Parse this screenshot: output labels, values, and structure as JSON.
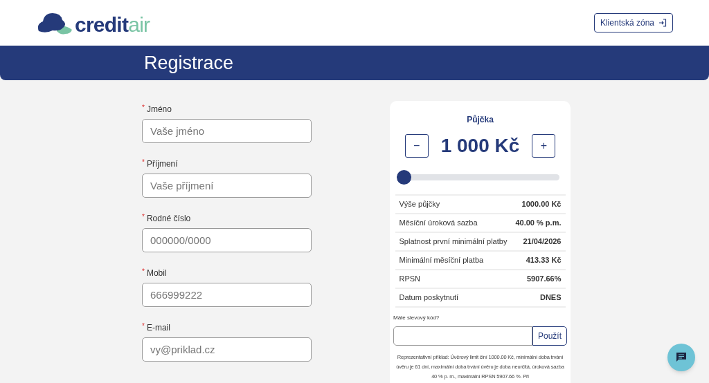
{
  "header": {
    "logo": {
      "part_1": "credit",
      "part_2": "air"
    },
    "client_button": "Klientská zóna"
  },
  "banner": {
    "title": "Registrace"
  },
  "form": {
    "fields": [
      {
        "required_mark": "*",
        "label": "Jméno",
        "placeholder": "Vaše jméno"
      },
      {
        "required_mark": "*",
        "label": "Příjmení",
        "placeholder": "Vaše příjmení"
      },
      {
        "required_mark": "*",
        "label": "Rodné číslo",
        "placeholder": "000000/0000"
      },
      {
        "required_mark": "*",
        "label": "Mobil",
        "placeholder": "666999222"
      },
      {
        "required_mark": "*",
        "label": "E-mail",
        "placeholder": "vy@priklad.cz"
      }
    ]
  },
  "loan_card": {
    "title": "Půjčka",
    "minus": "−",
    "amount": "1 000 Kč",
    "plus": "+",
    "slider": {
      "level": 0
    },
    "rows": [
      {
        "label": "Výše půjčky",
        "value": "1000.00 Kč"
      },
      {
        "label": "Měsíční úroková sazba",
        "value": "40.00 % p.m."
      },
      {
        "label": "Splatnost první minimální platby",
        "value": "21/04/2026"
      },
      {
        "label": "Minimální měsíční platba",
        "value": "413.33 Kč"
      },
      {
        "label": "RPSN",
        "value": "5907.66%"
      },
      {
        "label": "Datum poskytnutí",
        "value": "DNES"
      }
    ],
    "discount_label": "Máte slevový kód?",
    "apply_button": "Použít",
    "example": "Reprezentativní příklad: Úvěrový limit činí 1000.00 Kč, minimální doba trvání úvěru je 61 dní, maximální doba trvání úvěru je doba neurčitá, úroková sazba 40 % p. m., maximální RPSN 5907.66 %. Při"
  }
}
